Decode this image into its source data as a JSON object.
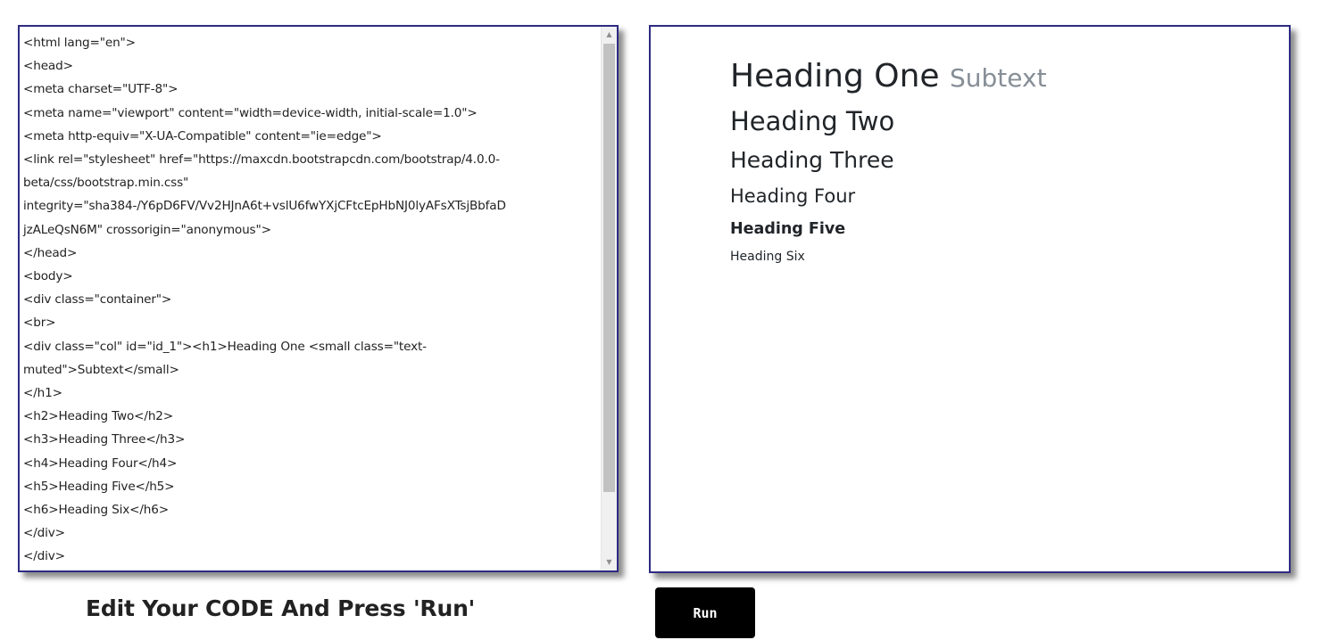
{
  "editor": {
    "code_lines": [
      "<html lang=\"en\">",
      "<head>",
      "<meta charset=\"UTF-8\">",
      "<meta name=\"viewport\" content=\"width=device-width, initial-scale=1.0\">",
      "<meta http-equiv=\"X-UA-Compatible\" content=\"ie=edge\">",
      "<link rel=\"stylesheet\" href=\"https://maxcdn.bootstrapcdn.com/bootstrap/4.0.0-",
      "beta/css/bootstrap.min.css\"",
      "integrity=\"sha384-/Y6pD6FV/Vv2HJnA6t+vslU6fwYXjCFtcEpHbNJ0lyAFsXTsjBbfaD",
      "jzALeQsN6M\" crossorigin=\"anonymous\">",
      "</head>",
      "<body>",
      "<div class=\"container\">",
      "<br>",
      "<div class=\"col\" id=\"id_1\"><h1>Heading One <small class=\"text-",
      "muted\">Subtext</small>",
      "</h1>",
      "<h2>Heading Two</h2>",
      "<h3>Heading Three</h3>",
      "<h4>Heading Four</h4>",
      "<h5>Heading Five</h5>",
      "<h6>Heading Six</h6>",
      "</div>",
      "</div>"
    ],
    "scroll_up_icon": "triangle-up",
    "scroll_down_icon": "triangle-down"
  },
  "preview": {
    "h1": "Heading One",
    "h1_subtext": "Subtext",
    "h2": "Heading Two",
    "h3": "Heading Three",
    "h4": "Heading Four",
    "h5": "Heading Five",
    "h6": "Heading Six"
  },
  "caption": "Edit Your CODE And Press 'Run'",
  "run_button": {
    "label": "Run"
  },
  "colors": {
    "panel_border": "#2e2a82",
    "muted_text": "#868e96",
    "button_bg": "#000000"
  }
}
